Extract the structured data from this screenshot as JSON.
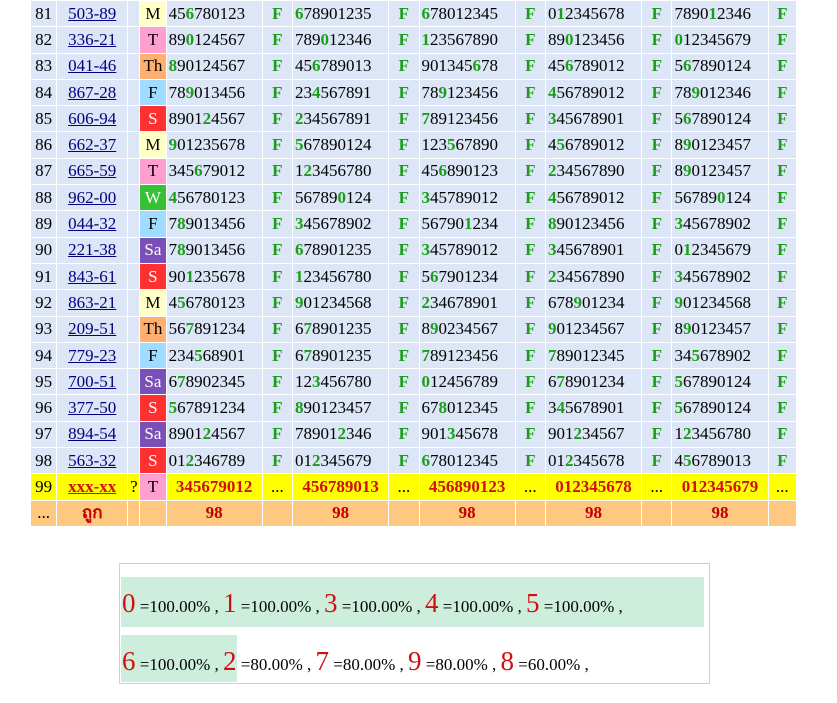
{
  "table": {
    "rows": [
      {
        "n": "81",
        "code": "503-89",
        "day": "M",
        "nums": [
          "456780123",
          "678901235",
          "678012345",
          "012345678",
          "789012346"
        ],
        "flag": "F"
      },
      {
        "n": "82",
        "code": "336-21",
        "day": "T",
        "nums": [
          "890124567",
          "789012346",
          "123567890",
          "890123456",
          "012345679"
        ],
        "flag": "F"
      },
      {
        "n": "83",
        "code": "041-46",
        "day": "Th",
        "nums": [
          "890124567",
          "456789013",
          "901345678",
          "456789012",
          "567890124"
        ],
        "flag": "F"
      },
      {
        "n": "84",
        "code": "867-28",
        "day": "F",
        "nums": [
          "789013456",
          "234567891",
          "789123456",
          "456789012",
          "789012346"
        ],
        "flag": "F"
      },
      {
        "n": "85",
        "code": "606-94",
        "day": "S",
        "nums": [
          "890124567",
          "234567891",
          "789123456",
          "345678901",
          "567890124"
        ],
        "flag": "F"
      },
      {
        "n": "86",
        "code": "662-37",
        "day": "M",
        "nums": [
          "901235678",
          "567890124",
          "123567890",
          "456789012",
          "890123457"
        ],
        "flag": "F"
      },
      {
        "n": "87",
        "code": "665-59",
        "day": "T",
        "nums": [
          "345679012",
          "123456780",
          "456890123",
          "234567890",
          "890123457"
        ],
        "flag": "F"
      },
      {
        "n": "88",
        "code": "962-00",
        "day": "W",
        "nums": [
          "456780123",
          "567890124",
          "345789012",
          "456789012",
          "567890124"
        ],
        "flag": "F"
      },
      {
        "n": "89",
        "code": "044-32",
        "day": "F",
        "nums": [
          "789013456",
          "345678902",
          "567901234",
          "890123456",
          "345678902"
        ],
        "flag": "F"
      },
      {
        "n": "90",
        "code": "221-38",
        "day": "Sa",
        "nums": [
          "789013456",
          "678901235",
          "345789012",
          "345678901",
          "012345679"
        ],
        "flag": "F"
      },
      {
        "n": "91",
        "code": "843-61",
        "day": "S",
        "nums": [
          "901235678",
          "123456780",
          "567901234",
          "234567890",
          "345678902"
        ],
        "flag": "F"
      },
      {
        "n": "92",
        "code": "863-21",
        "day": "M",
        "nums": [
          "456780123",
          "901234568",
          "234678901",
          "678901234",
          "901234568"
        ],
        "flag": "F"
      },
      {
        "n": "93",
        "code": "209-51",
        "day": "Th",
        "nums": [
          "567891234",
          "678901235",
          "890234567",
          "901234567",
          "890123457"
        ],
        "flag": "F"
      },
      {
        "n": "94",
        "code": "779-23",
        "day": "F",
        "nums": [
          "234568901",
          "678901235",
          "789123456",
          "789012345",
          "345678902"
        ],
        "flag": "F"
      },
      {
        "n": "95",
        "code": "700-51",
        "day": "Sa",
        "nums": [
          "678902345",
          "123456780",
          "012456789",
          "678901234",
          "567890124"
        ],
        "flag": "F"
      },
      {
        "n": "96",
        "code": "377-50",
        "day": "S",
        "nums": [
          "567891234",
          "890123457",
          "678012345",
          "345678901",
          "567890124"
        ],
        "flag": "F"
      },
      {
        "n": "97",
        "code": "894-54",
        "day": "Sa",
        "nums": [
          "890124567",
          "789012346",
          "901345678",
          "901234567",
          "123456780"
        ],
        "flag": "F"
      },
      {
        "n": "98",
        "code": "563-32",
        "day": "S",
        "nums": [
          "012346789",
          "012345679",
          "678012345",
          "012345678",
          "456789013"
        ],
        "flag": "F"
      }
    ],
    "prediction": {
      "n": "99",
      "code": "xxx-xx",
      "mark": "?",
      "day": "T",
      "nums": [
        "345679012",
        "456789013",
        "456890123",
        "012345678",
        "012345679"
      ],
      "dots": "..."
    },
    "totals": {
      "n": "...",
      "label": "ถูก",
      "values": [
        "98",
        "98",
        "98",
        "98",
        "98"
      ]
    }
  },
  "stats": {
    "line1": [
      {
        "digit": "0",
        "text": " =100.00% ,"
      },
      {
        "digit": "1",
        "text": " =100.00% ,"
      },
      {
        "digit": "3",
        "text": " =100.00% ,"
      },
      {
        "digit": "4",
        "text": " =100.00% ,"
      },
      {
        "digit": "5",
        "text": " =100.00% ,"
      }
    ],
    "line2": [
      {
        "digit": "6",
        "text": " =100.00% ,"
      },
      {
        "digit": "2",
        "text": " =80.00% ,"
      },
      {
        "digit": "7",
        "text": " =80.00% ,"
      },
      {
        "digit": "9",
        "text": " =80.00% ,"
      },
      {
        "digit": "8",
        "text": " =60.00% ,"
      }
    ]
  },
  "colors": {
    "hit": "#1a9e1a",
    "prediction_bg": "#ffff00",
    "prediction_text": "#d01010",
    "totals_bg": "#ffc880",
    "row_bg": "#dde6f7"
  }
}
